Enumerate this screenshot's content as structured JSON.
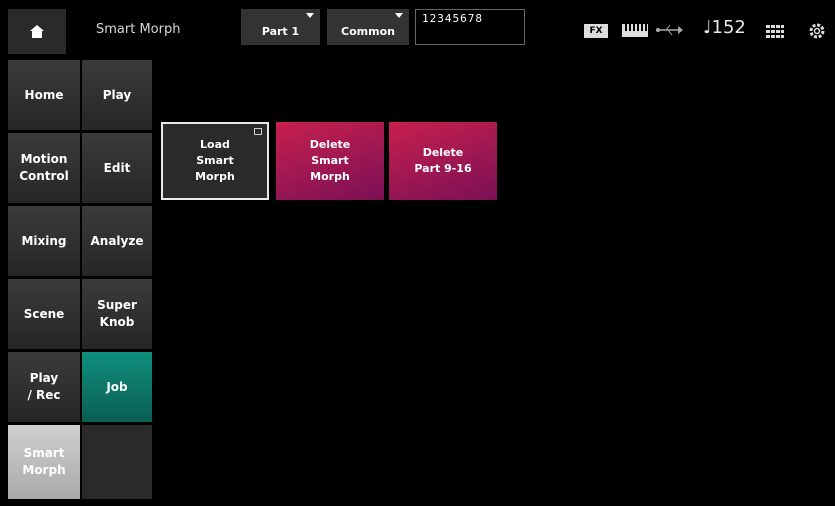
{
  "header": {
    "title": "Smart Morph",
    "part_selector": "Part 1",
    "common_selector": "Common",
    "part_numbers": "12345678",
    "fx_label": "FX",
    "tempo": "♩152"
  },
  "main_tabs": [
    {
      "label": "Home"
    },
    {
      "label": "Motion\nControl"
    },
    {
      "label": "Mixing"
    },
    {
      "label": "Scene"
    },
    {
      "label": "Play\n/ Rec"
    },
    {
      "label": "Smart\nMorph"
    }
  ],
  "sub_tabs": [
    {
      "label": "Play"
    },
    {
      "label": "Edit"
    },
    {
      "label": "Analyze"
    },
    {
      "label": "Super\nKnob"
    },
    {
      "label": "Job"
    },
    {
      "label": ""
    }
  ],
  "jobs": {
    "load": "Load\nSmart\nMorph",
    "delete_morph": "Delete\nSmart\nMorph",
    "delete_parts": "Delete\nPart 9-16"
  },
  "colors": {
    "active_main": "#bdbdbd",
    "active_sub": "#0f8f7c",
    "delete_button": "#b0204e"
  },
  "icons": [
    "home-icon",
    "keyboard-icon",
    "usb-icon",
    "grid-icon",
    "gear-icon"
  ]
}
